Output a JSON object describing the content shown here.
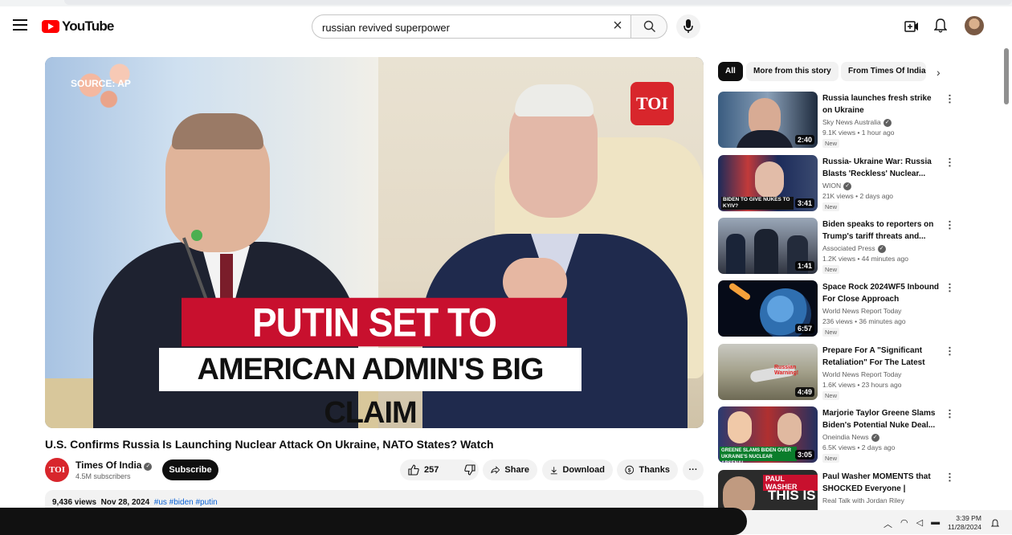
{
  "header": {
    "logo_text": "YouTube",
    "search_value": "russian revived superpower",
    "clear_glyph": "×"
  },
  "player": {
    "source_tag": "SOURCE: AP",
    "badge": "TOI",
    "headline_1": "PUTIN SET TO ATTACK?",
    "headline_2": "AMERICAN ADMIN'S BIG CLAIM"
  },
  "video": {
    "title": "U.S. Confirms Russia Is Launching Nuclear Attack On Ukraine, NATO States? Watch",
    "channel_avatar": "TOI",
    "channel_name": "Times Of India",
    "subscribers": "4.5M subscribers",
    "subscribe_label": "Subscribe",
    "likes": "257",
    "share_label": "Share",
    "download_label": "Download",
    "thanks_label": "Thanks",
    "more_glyph": "···",
    "views": "9,436 views",
    "date": "Nov 28, 2024",
    "hashtags": "#us #biden #putin"
  },
  "chips": [
    "All",
    "More from this story",
    "From Times Of India"
  ],
  "recommendations": [
    {
      "title": "Russia launches fresh strike on Ukraine",
      "channel": "Sky News Australia",
      "meta": "9.1K views • 1 hour ago",
      "badge": "New",
      "duration": "2:40",
      "thumb": "#4a6a8a"
    },
    {
      "title": "Russia- Ukraine War: Russia Blasts 'Reckless' Nuclear...",
      "channel": "WION",
      "meta": "21K views • 2 days ago",
      "badge": "New",
      "duration": "3:41",
      "thumb": "#22345e"
    },
    {
      "title": "Biden speaks to reporters on Trump's tariff threats and...",
      "channel": "Associated Press",
      "meta": "1.2K views • 44 minutes ago",
      "badge": "New",
      "duration": "1:41",
      "thumb": "#6a6f78"
    },
    {
      "title": "Space Rock 2024WF5 Inbound For Close Approach November...",
      "channel": "World News Report Today",
      "meta": "236 views • 36 minutes ago",
      "badge": "New",
      "duration": "6:57",
      "thumb": "#0d1b33"
    },
    {
      "title": "Prepare For A \"Significant Retaliation\" For The Latest Tw...",
      "channel": "World News Report Today",
      "meta": "1.6K views • 23 hours ago",
      "badge": "New",
      "duration": "4:49",
      "thumb": "#8b8f7a"
    },
    {
      "title": "Marjorie Taylor Greene Slams Biden's Potential Nuke Deal...",
      "channel": "Oneindia News",
      "meta": "6.5K views • 2 days ago",
      "badge": "New",
      "duration": "3:05",
      "thumb": "#2a3560"
    },
    {
      "title": "Paul Washer MOMENTS that SHOCKED Everyone | Christian...",
      "channel": "Real Talk with Jordan Riley",
      "meta": "",
      "badge": "",
      "duration": "",
      "thumb": "#2b2b2b"
    }
  ],
  "thumb_text": {
    "wion": "BIDEN TO GIVE NUKES TO KYIV?",
    "retaliation": "Russian Warning!",
    "mtg": "GREENE SLAMS BIDEN OVER UKRAINE'S NUCLEAR ARSENAL",
    "washer_1": "PAUL WASHER",
    "washer_2": "THIS IS"
  },
  "taskbar": {
    "time": "3:39 PM",
    "date": "11/28/2024"
  },
  "colors": {
    "brand_red": "#ff0000",
    "link_blue": "#065fd4"
  }
}
